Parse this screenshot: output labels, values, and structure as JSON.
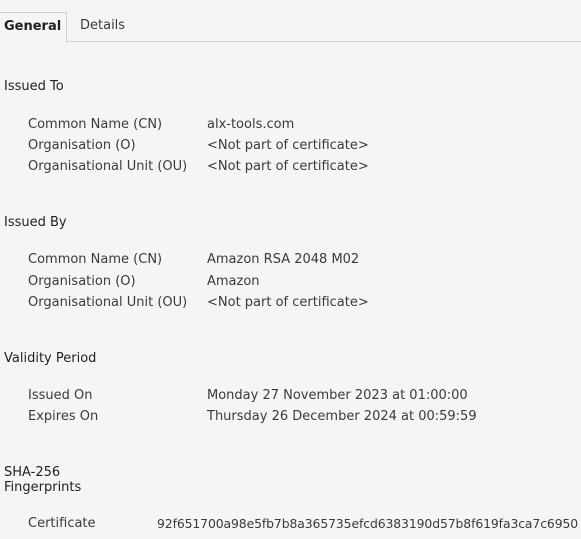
{
  "tabs": {
    "general": "General",
    "details": "Details"
  },
  "issued_to": {
    "title": "Issued To",
    "rows": [
      {
        "label": "Common Name (CN)",
        "value": "alx-tools.com"
      },
      {
        "label": "Organisation (O)",
        "value": "<Not part of certificate>"
      },
      {
        "label": "Organisational Unit (OU)",
        "value": "<Not part of certificate>"
      }
    ]
  },
  "issued_by": {
    "title": "Issued By",
    "rows": [
      {
        "label": "Common Name (CN)",
        "value": "Amazon RSA 2048 M02"
      },
      {
        "label": "Organisation (O)",
        "value": "Amazon"
      },
      {
        "label": "Organisational Unit (OU)",
        "value": "<Not part of certificate>"
      }
    ]
  },
  "validity": {
    "title": "Validity Period",
    "rows": [
      {
        "label": "Issued On",
        "value": "Monday 27 November 2023 at 01:00:00"
      },
      {
        "label": "Expires On",
        "value": "Thursday 26 December 2024 at 00:59:59"
      }
    ]
  },
  "fingerprints": {
    "title_line1": "SHA-256",
    "title_line2": "Fingerprints",
    "rows": [
      {
        "label": "Certificate",
        "value": "92f651700a98e5fb7b8a365735efcd6383190d57b8f619fa3ca7c6950"
      }
    ]
  }
}
